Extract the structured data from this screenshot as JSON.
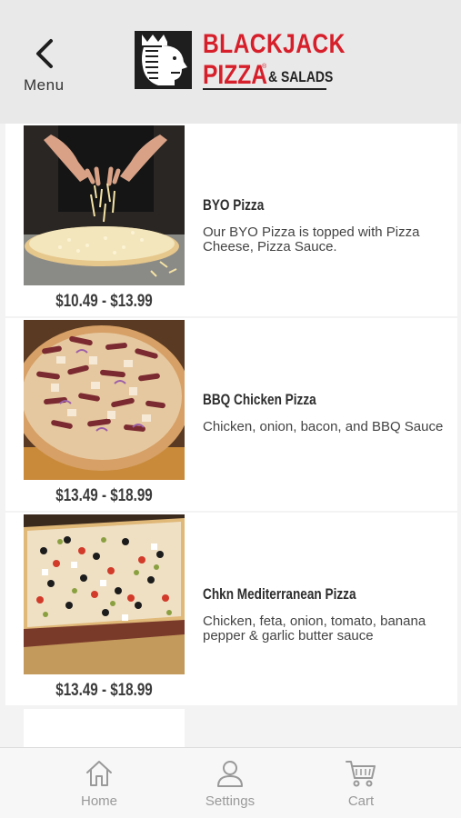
{
  "header": {
    "back_label": "Menu",
    "brand_line1": "BLACKJACK",
    "brand_line2": "PIZZA",
    "brand_reg": "®",
    "brand_line3": "& SALADS"
  },
  "items": [
    {
      "name": "BYO Pizza",
      "description": "Our BYO Pizza is topped with Pizza Cheese, Pizza Sauce.",
      "price": "$10.49 - $13.99"
    },
    {
      "name": "BBQ Chicken Pizza",
      "description": "Chicken, onion, bacon, and BBQ Sauce",
      "price": "$13.49 - $18.99"
    },
    {
      "name": "Chkn Mediterranean Pizza",
      "description": "Chicken, feta, onion, tomato, banana pepper & garlic butter sauce",
      "price": "$13.49 - $18.99"
    }
  ],
  "tabs": [
    {
      "label": "Home",
      "icon": "home-icon"
    },
    {
      "label": "Settings",
      "icon": "user-icon"
    },
    {
      "label": "Cart",
      "icon": "cart-icon"
    }
  ],
  "colors": {
    "brand_red": "#d61f2a",
    "header_bg": "#e9e9e9",
    "tab_gray": "#999999"
  }
}
